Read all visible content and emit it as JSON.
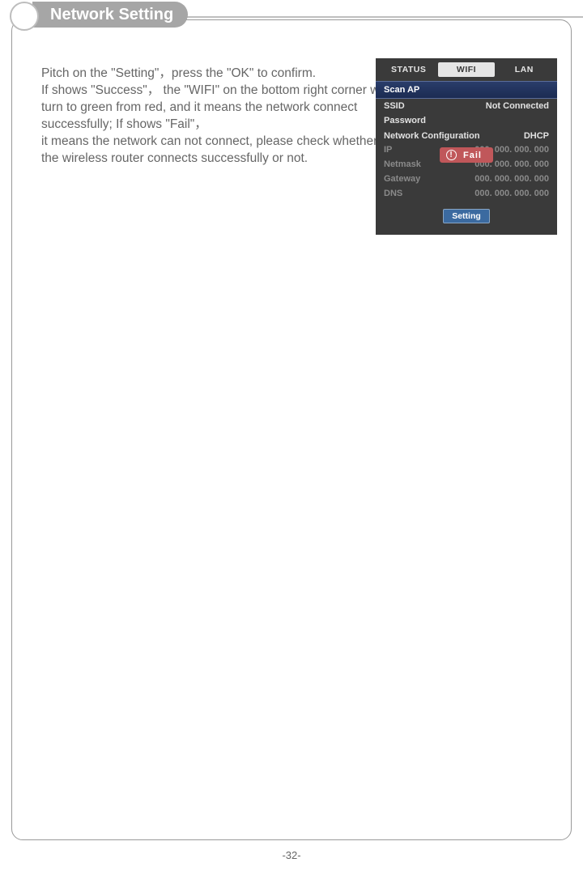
{
  "header": {
    "title": "Network Setting"
  },
  "instruction": "Pitch on the \"Setting\"，press the \"OK\" to confirm.\nIf shows \"Success\"， the \"WIFI\"  on the bottom right corner will turn to green from red, and it means the network connect successfully; If shows \"Fail\"，\nit means the network can not connect, please check whether the wireless router connects successfully or not.",
  "panel": {
    "tabs": {
      "status": "STATUS",
      "wifi": "WIFI",
      "lan": "LAN"
    },
    "scan_ap": "Scan AP",
    "ssid_label": "SSID",
    "ssid_value": "Not Connected",
    "password_label": "Password",
    "netconfig_label": "Network Configuration",
    "netconfig_value": "DHCP",
    "rows": {
      "ip_label": "IP",
      "ip_value": "000. 000. 000. 000",
      "netmask_label": "Netmask",
      "netmask_value": "000. 000. 000. 000",
      "gateway_label": "Gateway",
      "gateway_value": "000. 000. 000. 000",
      "dns_label": "DNS",
      "dns_value": "000. 000. 000. 000"
    },
    "fail_label": "Fail",
    "setting_button": "Setting"
  },
  "page_number": "-32-"
}
